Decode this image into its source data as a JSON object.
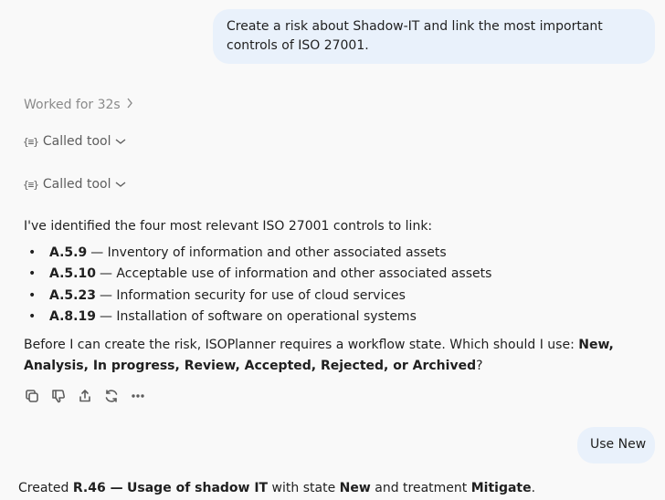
{
  "messages": {
    "user1": "Create a risk about Shadow-IT and link the most important controls of ISO 27001.",
    "user2": "Use New"
  },
  "assistant": {
    "worked": "Worked for 32s",
    "tool_calls": [
      "Called tool",
      "Called tool"
    ],
    "tool_icon": "{≡}",
    "intro": "I've identified the four most relevant ISO 27001 controls to link:",
    "controls": [
      {
        "id": "A.5.9",
        "text": "— Inventory of information and other associated assets"
      },
      {
        "id": "A.5.10",
        "text": "— Acceptable use of information and other associated assets"
      },
      {
        "id": "A.5.23",
        "text": "— Information security for use of cloud services"
      },
      {
        "id": "A.8.19",
        "text": "— Installation of software on operational systems"
      }
    ],
    "question_prefix": "Before I can create the risk, ISOPlanner requires a workflow state. Which should I use: ",
    "question_states": "New, Analysis, In progress, Review, Accepted, Rejected, or Archived",
    "question_suffix": "?"
  },
  "created": {
    "prefix": "Created ",
    "risk_id": "R.46 —",
    "risk_name": "Usage of shadow IT",
    "mid1": " with state ",
    "state": "New",
    "mid2": " and treatment ",
    "treatment": "Mitigate",
    "end": "."
  },
  "icons": [
    "copy-icon",
    "thumbs-down-icon",
    "share-icon",
    "regenerate-icon",
    "more-icon"
  ]
}
